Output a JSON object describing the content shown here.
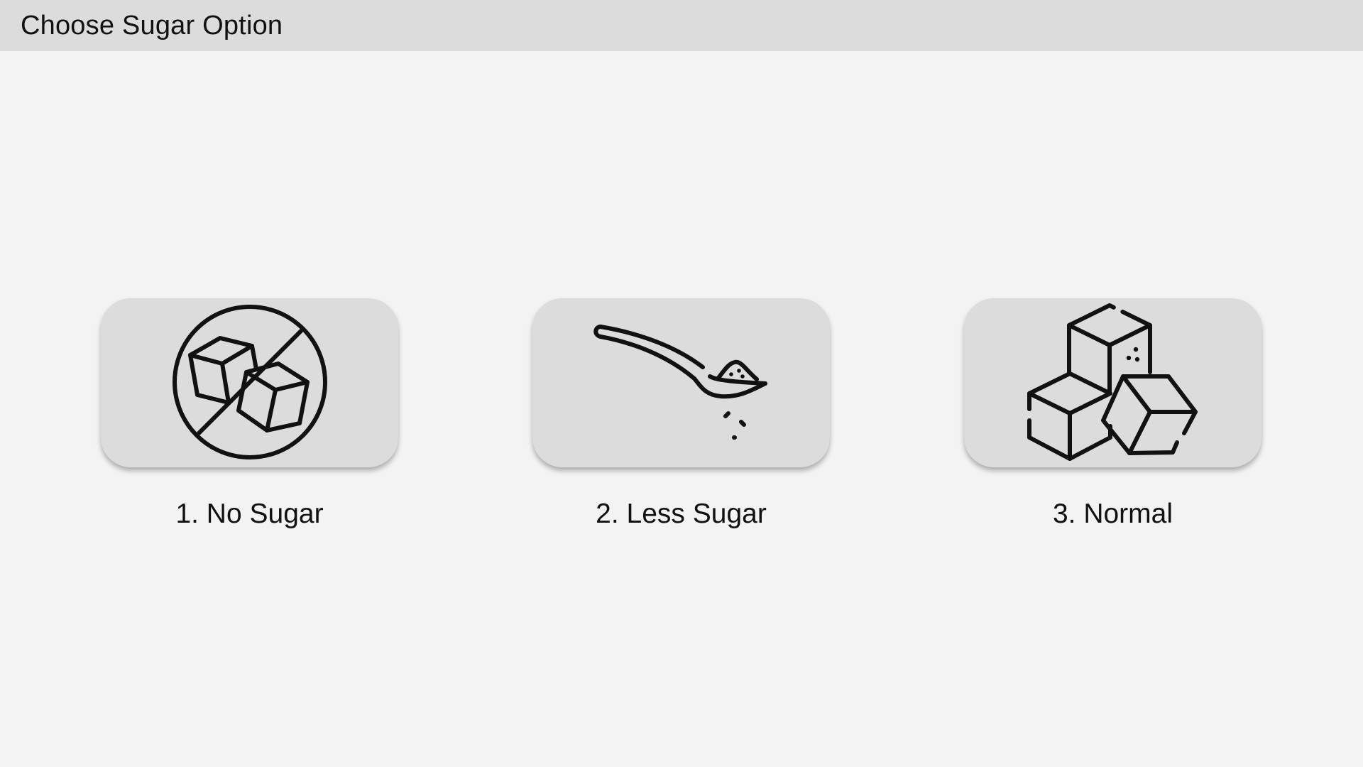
{
  "header": {
    "title": "Choose Sugar Option"
  },
  "options": [
    {
      "label": "1. No Sugar",
      "icon": "no-sugar-icon"
    },
    {
      "label": "2. Less Sugar",
      "icon": "spoon-sugar-icon"
    },
    {
      "label": "3. Normal",
      "icon": "sugar-cubes-icon"
    }
  ],
  "colors": {
    "background": "#f3f3f3",
    "header_bg": "#dcdcdc",
    "card_bg": "#dcdcdc",
    "icon": "#111111"
  }
}
